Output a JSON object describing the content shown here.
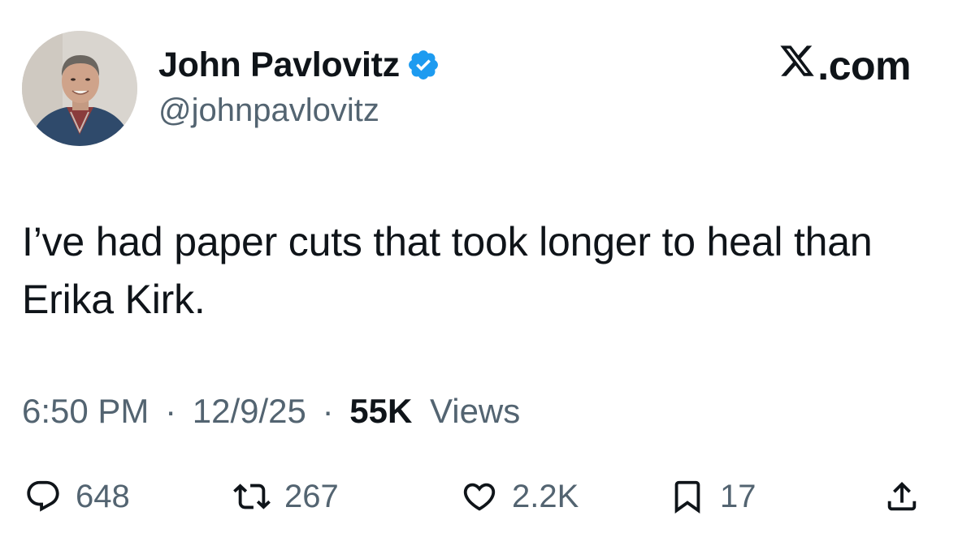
{
  "author": {
    "display_name": "John Pavlovitz",
    "handle": "@johnpavlovitz",
    "verified": true
  },
  "source": {
    "label": ".com",
    "logo": "x-logo"
  },
  "tweet": {
    "text": "I’ve had paper cuts that took longer to heal than Erika Kirk."
  },
  "meta": {
    "time": "6:50 PM",
    "separator": "·",
    "date": "12/9/25",
    "views_count": "55K",
    "views_label": "Views"
  },
  "actions": {
    "replies": "648",
    "reposts": "267",
    "likes": "2.2K",
    "bookmarks": "17"
  },
  "colors": {
    "text": "#0f1419",
    "secondary": "#536471",
    "verified": "#1d9bf0"
  },
  "icons": [
    "reply-icon",
    "repost-icon",
    "like-icon",
    "bookmark-icon",
    "share-icon",
    "verified-badge-icon",
    "x-logo-icon"
  ]
}
